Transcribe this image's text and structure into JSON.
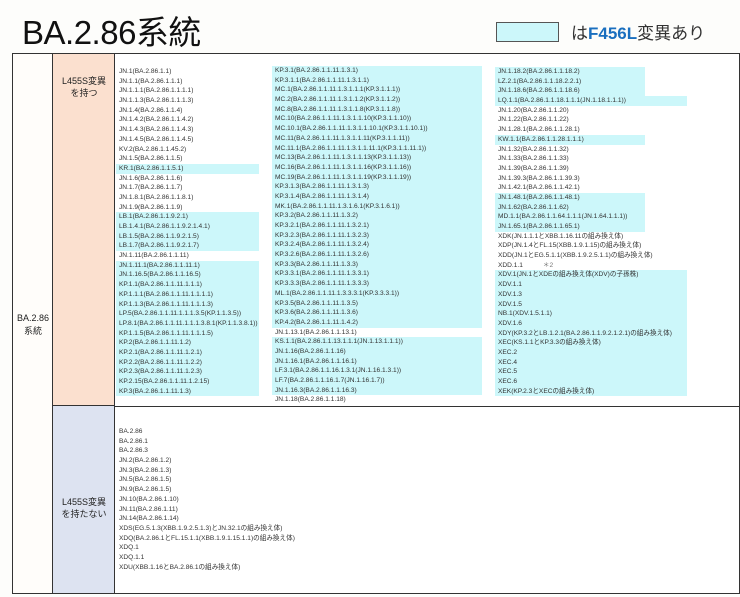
{
  "header": {
    "title": "BA.2.86系統",
    "legend_prefix": "は",
    "legend_mutation": "F456L",
    "legend_suffix": "変異あり",
    "legend_color": "#ccf7fa"
  },
  "table": {
    "lineage_label_line1": "BA.2.86",
    "lineage_label_line2": "系統",
    "groups": [
      {
        "label_line1": "L455S変異",
        "label_line2": "を持つ",
        "color": "#fbe0cf"
      },
      {
        "label_line1": "L455S変異",
        "label_line2": "を持たない",
        "color": "#dde3f1"
      }
    ],
    "with_l455s": {
      "col1": [
        {
          "text": "JN.1(BA.2.86.1.1)",
          "f456l": false
        },
        {
          "text": "JN.1.1(BA.2.86.1.1.1)",
          "f456l": false
        },
        {
          "text": "JN.1.1.1(BA.2.86.1.1.1.1)",
          "f456l": false
        },
        {
          "text": "JN.1.1.3(BA.2.86.1.1.1.3)",
          "f456l": false
        },
        {
          "text": "JN.1.4(BA.2.86.1.1.4)",
          "f456l": false
        },
        {
          "text": "JN.1.4.2(BA.2.86.1.1.4.2)",
          "f456l": false
        },
        {
          "text": "JN.1.4.3(BA.2.86.1.1.4.3)",
          "f456l": false
        },
        {
          "text": "JN.1.4.5(BA.2.86.1.1.4.5)",
          "f456l": false
        },
        {
          "text": "KV.2(BA.2.86.1.1.45.2)",
          "f456l": false
        },
        {
          "text": "JN.1.5(BA.2.86.1.1.5)",
          "f456l": false
        },
        {
          "text": "KR.1(BA.2.86.1.1.5.1)",
          "f456l": true
        },
        {
          "text": "JN.1.6(BA.2.86.1.1.6)",
          "f456l": false
        },
        {
          "text": "JN.1.7(BA.2.86.1.1.7)",
          "f456l": false
        },
        {
          "text": "JN.1.8.1(BA.2.86.1.1.8.1)",
          "f456l": false
        },
        {
          "text": "JN.1.9(BA.2.86.1.1.9)",
          "f456l": false
        },
        {
          "text": "LB.1(BA.2.86.1.1.9.2.1)",
          "f456l": true
        },
        {
          "text": "LB.1.4.1(BA.2.86.1.1.9.2.1.4.1)",
          "f456l": true
        },
        {
          "text": "LB.1.5(BA.2.86.1.1.9.2.1.5)",
          "f456l": true
        },
        {
          "text": "LB.1.7(BA.2.86.1.1.9.2.1.7)",
          "f456l": true
        },
        {
          "text": "JN.1.11(BA.2.86.1.1.11)",
          "f456l": false
        },
        {
          "text": "JN.1.11.1(BA.2.86.1.1.11.1)",
          "f456l": true
        },
        {
          "text": "JN.1.16.5(BA.2.86.1.1.16.5)",
          "f456l": true
        },
        {
          "text": "KP.1.1(BA.2.86.1.1.11.1.1.1)",
          "f456l": true
        },
        {
          "text": "KP.1.1.1(BA.2.86.1.1.11.1.1.1.1)",
          "f456l": true
        },
        {
          "text": "KP.1.1.3(BA.2.86.1.1.11.1.1.1.3)",
          "f456l": true
        },
        {
          "text": "LP.5(BA.2.86.1.1.11.1.1.1.3.5(KP.1.1.3.5))",
          "f456l": true
        },
        {
          "text": "LP.8.1(BA.2.86.1.1.11.1.1.1.3.8.1(KP.1.1.3.8.1))",
          "f456l": true
        },
        {
          "text": "KP.1.1.5(BA.2.86.1.1.11.1.1.1.5)",
          "f456l": true
        },
        {
          "text": "KP.2(BA.2.86.1.1.11.1.2)",
          "f456l": true
        },
        {
          "text": "KP.2.1(BA.2.86.1.1.11.1.2.1)",
          "f456l": true
        },
        {
          "text": "KP.2.2(BA.2.86.1.1.11.1.2.2)",
          "f456l": true
        },
        {
          "text": "KP.2.3(BA.2.86.1.1.11.1.2.3)",
          "f456l": true
        },
        {
          "text": "KP.2.15(BA.2.86.1.1.11.1.2.15)",
          "f456l": true
        },
        {
          "text": "KP.3(BA.2.86.1.1.11.1.3)",
          "f456l": true
        }
      ],
      "col2": [
        {
          "text": "KP.3.1(BA.2.86.1.1.11.1.3.1)",
          "f456l": true
        },
        {
          "text": "KP.3.1.1(BA.2.86.1.1.11.1.3.1.1)",
          "f456l": true
        },
        {
          "text": "MC.1(BA.2.86.1.1.11.1.3.1.1.1(KP.3.1.1.1))",
          "f456l": true
        },
        {
          "text": "MC.2(BA.2.86.1.1.11.1.3.1.1.2(KP.3.1.1.2))",
          "f456l": true
        },
        {
          "text": "MC.8(BA.2.86.1.1.11.1.3.1.1.8(KP.3.1.1.8))",
          "f456l": true
        },
        {
          "text": "MC.10(BA.2.86.1.1.11.1.3.1.1.10(KP.3.1.1.10))",
          "f456l": true
        },
        {
          "text": "MC.10.1(BA.2.86.1.1.11.1.3.1.1.10.1(KP.3.1.1.10.1))",
          "f456l": true
        },
        {
          "text": "MC.11(BA.2.86.1.1.11.1.3.1.1.11(KP.3.1.1.11))",
          "f456l": true
        },
        {
          "text": "MC.11.1(BA.2.86.1.1.11.1.3.1.1.11.1(KP.3.1.1.11.1))",
          "f456l": true
        },
        {
          "text": "MC.13(BA.2.86.1.1.11.1.3.1.1.13(KP.3.1.1.13))",
          "f456l": true
        },
        {
          "text": "MC.16(BA.2.86.1.1.11.1.3.1.1.16(KP.3.1.1.16))",
          "f456l": true
        },
        {
          "text": "MC.19(BA.2.86.1.1.11.1.3.1.1.19(KP.3.1.1.19))",
          "f456l": true
        },
        {
          "text": "KP.3.1.3(BA.2.86.1.1.11.1.3.1.3)",
          "f456l": true
        },
        {
          "text": "KP.3.1.4(BA.2.86.1.1.11.1.3.1.4)",
          "f456l": true
        },
        {
          "text": "MK.1(BA.2.86.1.1.11.1.3.1.6.1(KP.3.1.6.1))",
          "f456l": true
        },
        {
          "text": "KP.3.2(BA.2.86.1.1.11.1.3.2)",
          "f456l": true
        },
        {
          "text": "KP.3.2.1(BA.2.86.1.1.11.1.3.2.1)",
          "f456l": true
        },
        {
          "text": "KP.3.2.3(BA.2.86.1.1.11.1.3.2.3)",
          "f456l": true
        },
        {
          "text": "KP.3.2.4(BA.2.86.1.1.11.1.3.2.4)",
          "f456l": true
        },
        {
          "text": "KP.3.2.6(BA.2.86.1.1.11.1.3.2.6)",
          "f456l": true
        },
        {
          "text": "KP.3.3(BA.2.86.1.1.11.1.3.3)",
          "f456l": true
        },
        {
          "text": "KP.3.3.1(BA.2.86.1.1.11.1.3.3.1)",
          "f456l": true
        },
        {
          "text": "KP.3.3.3(BA.2.86.1.1.11.1.3.3.3)",
          "f456l": true
        },
        {
          "text": "ML.1(BA.2.86.1.1.11.1.3.3.3.1(KP.3.3.3.1))",
          "f456l": true
        },
        {
          "text": "KP.3.5(BA.2.86.1.1.11.1.3.5)",
          "f456l": true
        },
        {
          "text": "KP.3.6(BA.2.86.1.1.11.1.3.6)",
          "f456l": true
        },
        {
          "text": "KP.4.2(BA.2.86.1.1.11.1.4.2)",
          "f456l": true
        },
        {
          "text": "JN.1.13.1(BA.2.86.1.1.13.1)",
          "f456l": false
        },
        {
          "text": "KS.1.1(BA.2.86.1.1.13.1.1.1(JN.1.13.1.1.1))",
          "f456l": true
        },
        {
          "text": "JN.1.16(BA.2.86.1.1.16)",
          "f456l": true
        },
        {
          "text": "JN.1.16.1(BA.2.86.1.1.16.1)",
          "f456l": true
        },
        {
          "text": "LF.3.1(BA.2.86.1.1.16.1.3.1(JN.1.16.1.3.1))",
          "f456l": true
        },
        {
          "text": "LF.7(BA.2.86.1.1.16.1.7(JN.1.16.1.7))",
          "f456l": true
        },
        {
          "text": "JN.1.16.3(BA.2.86.1.1.16.3)",
          "f456l": true
        },
        {
          "text": "JN.1.18(BA.2.86.1.1.18)",
          "f456l": false
        }
      ],
      "col3": [
        {
          "text": "JN.1.18.2(BA.2.86.1.1.18.2)",
          "f456l": true
        },
        {
          "text": "LZ.2.1(BA.2.86.1.1.18.2.2.1)",
          "f456l": true
        },
        {
          "text": "JN.1.18.6(BA.2.86.1.1.18.6)",
          "f456l": true
        },
        {
          "text": "LQ.1.1(BA.2.86.1.1.18.1.1.1(JN.1.18.1.1.1))",
          "f456l": true
        },
        {
          "text": "JN.1.20(BA.2.86.1.1.20)",
          "f456l": false
        },
        {
          "text": "JN.1.22(BA.2.86.1.1.22)",
          "f456l": false
        },
        {
          "text": "JN.1.28.1(BA.2.86.1.1.28.1)",
          "f456l": false
        },
        {
          "text": "KW.1.1(BA.2.86.1.1.28.1.1.1)",
          "f456l": true
        },
        {
          "text": "JN.1.32(BA.2.86.1.1.32)",
          "f456l": false
        },
        {
          "text": "JN.1.33(BA.2.86.1.1.33)",
          "f456l": false
        },
        {
          "text": "JN.1.39(BA.2.86.1.1.39)",
          "f456l": false
        },
        {
          "text": "JN.1.39.3(BA.2.86.1.1.39.3)",
          "f456l": false
        },
        {
          "text": "JN.1.42.1(BA.2.86.1.1.42.1)",
          "f456l": false
        },
        {
          "text": "JN.1.48.1(BA.2.86.1.1.48.1)",
          "f456l": true
        },
        {
          "text": "JN.1.62(BA.2.86.1.1.62)",
          "f456l": true
        },
        {
          "text": "MD.1.1(BA.2.86.1.1.64.1.1.1(JN.1.64.1.1.1))",
          "f456l": true
        },
        {
          "text": "JN.1.65.1(BA.2.86.1.1.65.1)",
          "f456l": true
        },
        {
          "text": "XDK(JN.1.1.1とXBB.1.16.11の組み換え体)",
          "f456l": false
        },
        {
          "text": "XDP(JN.1.4とFL.15(XBB.1.9.1.15)の組み換え体)",
          "f456l": false
        },
        {
          "text": "XDD(JN.1とEG.5.1.1(XBB.1.9.2.5.1.1)の組み換え体)",
          "f456l": false
        },
        {
          "text": "XDD.1.1",
          "f456l": false,
          "note": "＊2"
        },
        {
          "text": "XDV.1(JN.1とXDEの組み換え体(XDV)の子孫株)",
          "f456l": true
        },
        {
          "text": "XDV.1.1",
          "f456l": true
        },
        {
          "text": "XDV.1.3",
          "f456l": true
        },
        {
          "text": "XDV.1.5",
          "f456l": true
        },
        {
          "text": "NB.1(XDV.1.5.1.1)",
          "f456l": true
        },
        {
          "text": "XDV.1.6",
          "f456l": true
        },
        {
          "text": "XDY(KP.3.2とLB.1.2.1(BA.2.86.1.1.9.2.1.2.1)の組み換え体)",
          "f456l": true
        },
        {
          "text": "XEC(KS.1.1とKP.3.3の組み換え体)",
          "f456l": true
        },
        {
          "text": "XEC.2",
          "f456l": true
        },
        {
          "text": "XEC.4",
          "f456l": true
        },
        {
          "text": "XEC.5",
          "f456l": true
        },
        {
          "text": "XEC.6",
          "f456l": true
        },
        {
          "text": "XEK(KP.2.3とXECの組み換え体)",
          "f456l": true
        }
      ]
    },
    "without_l455s": [
      "BA.2.86",
      "BA.2.86.1",
      "BA.2.86.3",
      "JN.2(BA.2.86.1.2)",
      "JN.3(BA.2.86.1.3)",
      "JN.5(BA.2.86.1.5)",
      "JN.9(BA.2.86.1.5)",
      "JN.10(BA.2.86.1.10)",
      "JN.11(BA.2.86.1.11)",
      "JN.14(BA.2.86.1.14)",
      "XDS(EG.5.1.3(XBB.1.9.2.5.1.3)とJN.32.1の組み換え体)",
      "XDQ(BA.2.86.1とFL.15.1.1(XBB.1.9.1.15.1.1)の組み換え体)",
      "XDQ.1",
      "XDQ.1.1",
      "XDU(XBB.1.16とBA.2.86.1の組み換え体)"
    ]
  }
}
